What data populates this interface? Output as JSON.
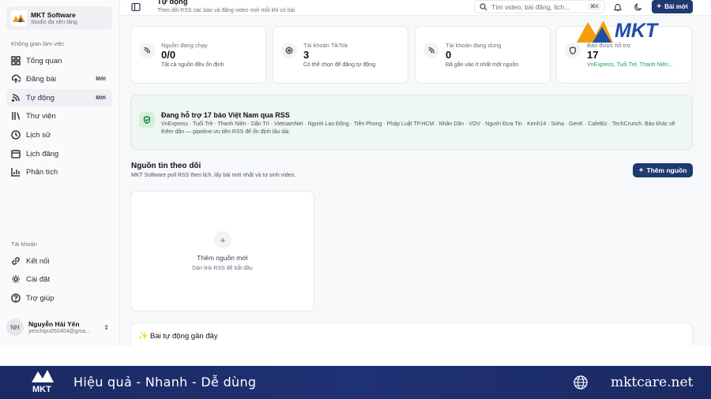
{
  "brand": {
    "name": "MKT Software",
    "subtitle": "Studio đa nền tảng"
  },
  "sidebar": {
    "workspace_label": "Không gian làm việc",
    "items": [
      {
        "label": "Tổng quan",
        "icon": "grid-icon",
        "badge": ""
      },
      {
        "label": "Đăng bài",
        "icon": "upload-icon",
        "badge": "Mới"
      },
      {
        "label": "Tự động",
        "icon": "rss-icon",
        "badge": "Mới",
        "active": true
      },
      {
        "label": "Thư viện",
        "icon": "library-icon",
        "badge": ""
      },
      {
        "label": "Lịch sử",
        "icon": "clock-icon",
        "badge": ""
      },
      {
        "label": "Lịch đăng",
        "icon": "calendar-icon",
        "badge": ""
      },
      {
        "label": "Phân tích",
        "icon": "chart-icon",
        "badge": ""
      }
    ],
    "account_label": "Tài khoản",
    "account_items": [
      {
        "label": "Kết nối",
        "icon": "link-icon"
      },
      {
        "label": "Cài đặt",
        "icon": "gear-icon"
      },
      {
        "label": "Trợ giúp",
        "icon": "help-icon"
      }
    ],
    "user": {
      "initials": "NH",
      "name": "Nguyễn Hải Yến",
      "email": "yenchipu050404@gma..."
    }
  },
  "header": {
    "title": "Tự động",
    "subtitle": "Theo dõi RSS các báo và đăng video mới mỗi khi có bài",
    "search_placeholder": "Tìm video, bài đăng, lịch...",
    "search_shortcut": "⌘K",
    "new_post_label": "Bài mới"
  },
  "stats": [
    {
      "label": "Nguồn đang chạy",
      "value": "0/0",
      "desc": "Tất cả nguồn đều ổn định",
      "icon": "rss-icon"
    },
    {
      "label": "Tài khoản TikTok",
      "value": "3",
      "desc": "Có thể chọn để đăng tự động",
      "icon": "target-icon"
    },
    {
      "label": "Tài khoản đang dùng",
      "value": "0",
      "desc": "Đã gắn vào ít nhất một nguồn",
      "icon": "rss-icon"
    },
    {
      "label": "Báo được hỗ trợ",
      "value": "17",
      "desc": "VnExpress, Tuổi Trẻ, Thanh Niên...",
      "icon": "shield-icon"
    }
  ],
  "rss_banner": {
    "title": "Đang hỗ trợ 17 báo Việt Nam qua RSS",
    "text": "VnExpress · Tuổi Trẻ · Thanh Niên · Dân Trí · VietnamNet · Người Lao Động · Tiền Phong · Pháp Luật TP.HCM · Nhân Dân · VOV · Người Đưa Tin · Kenh14 · Soha · GenK · CafeBiz · TechCrunch. Báo khác sẽ thêm dần — pipeline ưu tiên RSS để ổn định lâu dài."
  },
  "sources": {
    "title": "Nguồn tin theo dõi",
    "subtitle": "MKT Software poll RSS theo lịch, lấy bài mới nhất và tự sinh video.",
    "add_label": "Thêm nguồn",
    "empty_title": "Thêm nguồn mới",
    "empty_sub": "Dán link RSS để bắt đầu"
  },
  "recent": {
    "title": "Bài tự động gần đây"
  },
  "watermark": {
    "logo_text": "MKT"
  },
  "footer": {
    "tagline": "Hiệu quả - Nhanh - Dễ dùng",
    "site": "mktcare.net"
  },
  "colors": {
    "primary": "#1e3a70",
    "accent_green": "#16a34a",
    "footer_bg": "#1b2a63",
    "logo_orange": "#f59e0b",
    "logo_blue": "#1d4fa8"
  }
}
